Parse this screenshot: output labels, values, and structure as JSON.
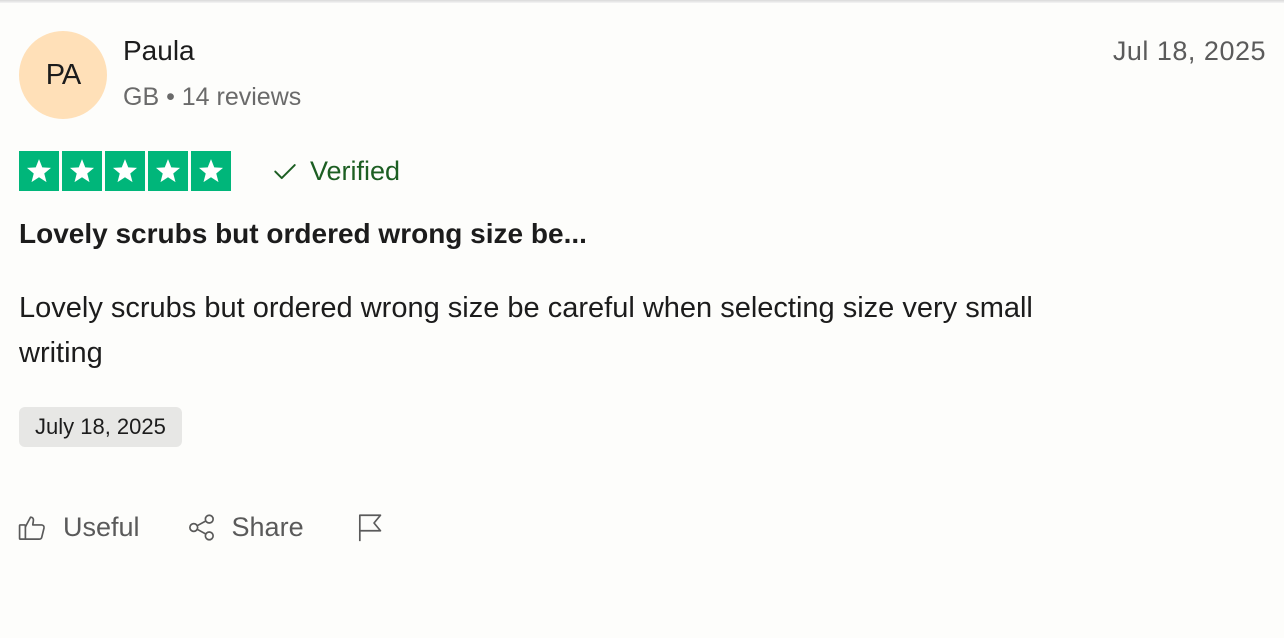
{
  "reviewer": {
    "initials": "PA",
    "name": "Paula",
    "meta": "GB • 14 reviews"
  },
  "review": {
    "date_short": "Jul 18, 2025",
    "rating_stars": 5,
    "rating_max": 5,
    "verified_label": "Verified",
    "title": "Lovely scrubs but ordered wrong size be...",
    "body": "Lovely scrubs but ordered wrong size be careful when selecting size very small writing",
    "experience_date": "July 18, 2025"
  },
  "actions": {
    "useful_label": "Useful",
    "share_label": "Share"
  },
  "colors": {
    "star_green": "#00b67a",
    "verified_green": "#1c5e22",
    "avatar_bg": "#ffe0b8"
  },
  "icons": {
    "verified": "check-icon",
    "useful": "thumbs-up-icon",
    "share": "share-icon",
    "report": "flag-icon"
  }
}
